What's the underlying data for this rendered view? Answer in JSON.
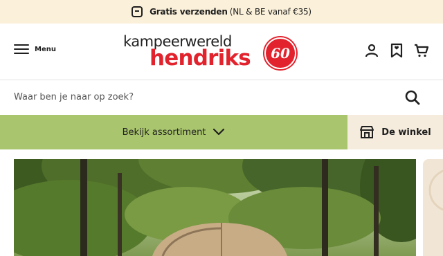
{
  "topbar": {
    "bold": "Gratis verzenden",
    "rest": "(NL & BE vanaf €35)"
  },
  "header": {
    "menu_label": "Menu",
    "logo_top": "kampeerwereld",
    "logo_bottom": "hendriks",
    "logo_seal": "60",
    "icons": [
      "account-icon",
      "wishlist-icon",
      "cart-icon"
    ]
  },
  "search": {
    "placeholder": "Waar ben je naar op zoek?"
  },
  "nav": {
    "assortment_label": "Bekijk assortiment",
    "store_label": "De winkel"
  },
  "colors": {
    "topbar_bg": "#fbf0d9",
    "brand_red": "#e2232d",
    "nav_green": "#a9c56d",
    "store_bg": "#f5ecdd"
  }
}
